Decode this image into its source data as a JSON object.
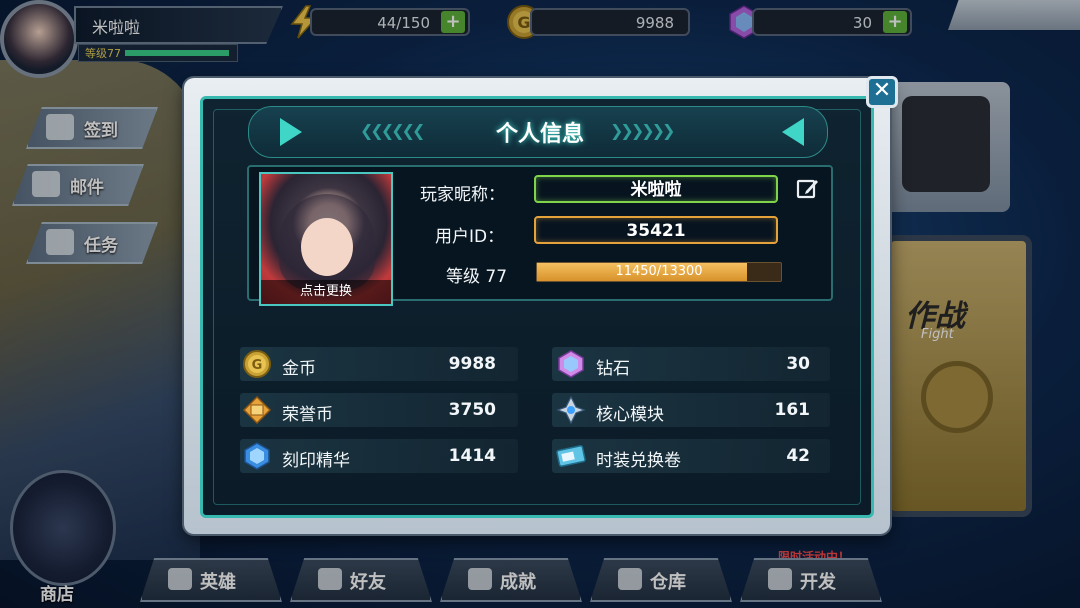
{
  "topbar": {
    "player_name": "米啦啦",
    "level_label": "等级77",
    "energy": "44/150",
    "gold": "9988",
    "diamonds": "30",
    "plus": "+"
  },
  "side_menu": {
    "checkin": "签到",
    "mail": "邮件",
    "tasks": "任务",
    "shop": "商店"
  },
  "bottom_nav": [
    "英雄",
    "好友",
    "成就",
    "仓库",
    "开发"
  ],
  "event_tag": "限时活动中！",
  "fight_card": {
    "zh": "作战",
    "en": "Fight"
  },
  "modal": {
    "title": "个人信息",
    "close": "✕",
    "portrait_caption": "点击更换",
    "nickname_label": "玩家昵称：",
    "nickname": "米啦啦",
    "userid_label": "用户ID：",
    "userid": "35421",
    "level_label": "等级 77",
    "exp_text": "11450/13300",
    "exp_fraction": 0.861,
    "currencies_left": [
      {
        "name": "金币",
        "value": "9988",
        "icon": "gold-coin-icon"
      },
      {
        "name": "荣誉币",
        "value": "3750",
        "icon": "honor-coin-icon"
      },
      {
        "name": "刻印精华",
        "value": "1414",
        "icon": "engraving-essence-icon"
      }
    ],
    "currencies_right": [
      {
        "name": "钻石",
        "value": "30",
        "icon": "diamond-icon"
      },
      {
        "name": "核心模块",
        "value": "161",
        "icon": "core-module-icon"
      },
      {
        "name": "时装兑换卷",
        "value": "42",
        "icon": "costume-voucher-icon"
      }
    ]
  },
  "colors": {
    "accent_teal": "#37b9b0",
    "nickname_border": "#7fd44a",
    "userid_border": "#e3a23a",
    "exp_fill": "#e6a63f",
    "plus_green": "#5fb23c"
  }
}
